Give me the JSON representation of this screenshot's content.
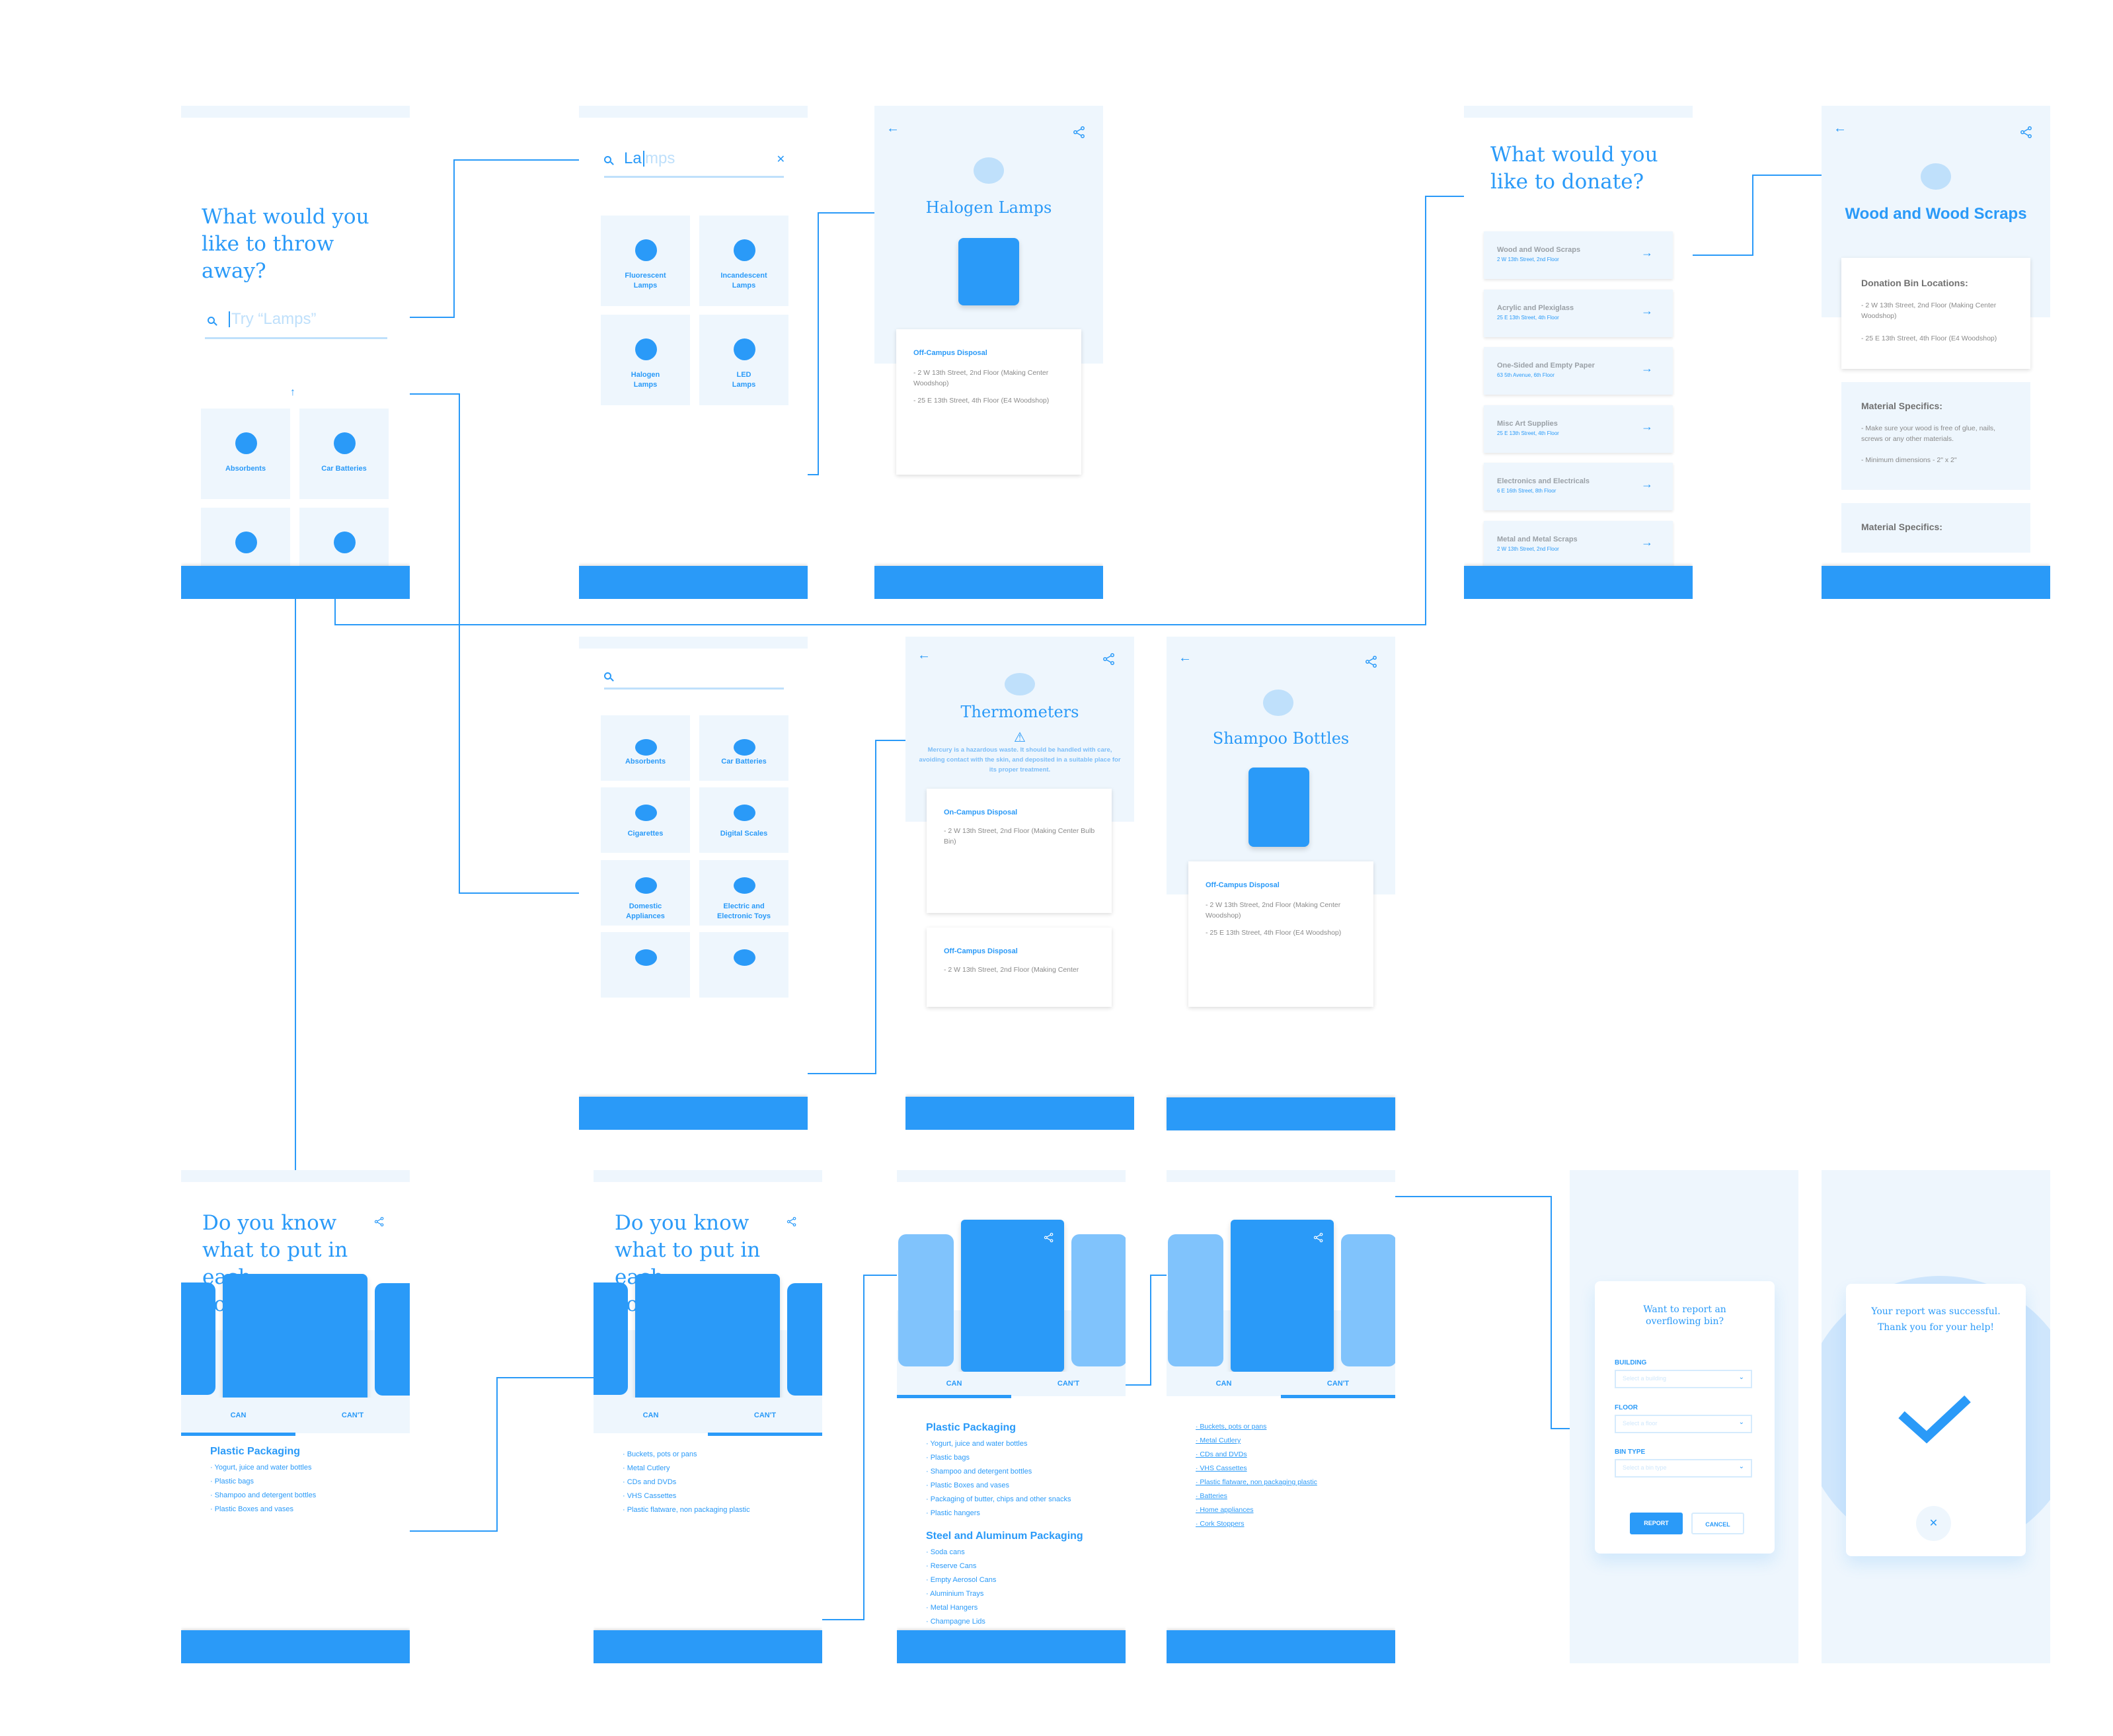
{
  "colors": {
    "primary": "#2a9af8",
    "light": "#eef6fd",
    "pale": "#bfe0fb",
    "muted_text": "#8a8a8a"
  },
  "screens": {
    "throw_home": {
      "title": "What would you like to throw away?",
      "search_placeholder": "Try “Lamps”",
      "scroll_up_icon": "↑",
      "categories": [
        {
          "label": "Absorbents"
        },
        {
          "label": "Car Batteries"
        },
        {
          "label": ""
        },
        {
          "label": ""
        }
      ]
    },
    "search_results": {
      "query_typed": "La",
      "query_suggest": "mps",
      "clear_icon": "✕",
      "results": [
        {
          "label": "Fluorescent Lamps"
        },
        {
          "label": "Incandescent Lamps"
        },
        {
          "label": "Halogen Lamps"
        },
        {
          "label": "LED Lamps"
        }
      ]
    },
    "halogen_detail": {
      "back_icon": "←",
      "title": "Halogen Lamps",
      "card_title": "Off-Campus Disposal",
      "addresses": [
        "- 2 W 13th Street, 2nd Floor (Making Center Woodshop)",
        "- 25 E 13th Street, 4th Floor (E4 Woodshop)"
      ]
    },
    "donate_list": {
      "title": "What would you like to donate?",
      "arrow_icon": "→",
      "items": [
        {
          "name": "Wood and Wood Scraps",
          "address": "2 W 13th Street, 2nd Floor"
        },
        {
          "name": "Acrylic and Plexiglass",
          "address": "25 E 13th Street, 4th Floor"
        },
        {
          "name": "One-Sided and Empty Paper",
          "address": "63 5th Avenue, 6th Floor"
        },
        {
          "name": "Misc Art Supplies",
          "address": "25 E 13th Street, 4th Floor"
        },
        {
          "name": "Electronics and Electricals",
          "address": "6 E 16th Street, 8th Floor"
        },
        {
          "name": "Metal and Metal Scraps",
          "address": "2 W 13th Street, 2nd Floor"
        }
      ]
    },
    "wood_detail": {
      "back_icon": "←",
      "title": "Wood and Wood Scraps",
      "bins_title": "Donation Bin Locations:",
      "bins": [
        "- 2 W 13th Street, 2nd Floor (Making Center Woodshop)",
        "- 25 E 13th Street, 4th Floor (E4 Woodshop)"
      ],
      "specifics_title": "Material Specifics:",
      "specifics": [
        "- Make sure your wood is free of glue, nails, screws or any other materials.",
        "- Minimum dimensions - 2\" x 2\""
      ],
      "specifics2_title": "Material Specifics:"
    },
    "category_list": {
      "categories": [
        {
          "label": "Absorbents"
        },
        {
          "label": "Car Batteries"
        },
        {
          "label": "Cigarettes"
        },
        {
          "label": "Digital Scales"
        },
        {
          "label": "Domestic Appliances"
        },
        {
          "label": "Electric and Electronic Toys"
        },
        {
          "label": ""
        },
        {
          "label": ""
        }
      ]
    },
    "thermometer_detail": {
      "back_icon": "←",
      "title": "Thermometers",
      "warning_icon": "⚠",
      "warning": "Mercury is a hazardous waste. It should be handled with care, avoiding contact with the skin, and deposited in a suitable place for its proper treatment.",
      "card1_title": "On-Campus Disposal",
      "card1_addresses": [
        "- 2 W 13th Street, 2nd Floor (Making Center Bulb Bin)"
      ],
      "card2_title": "Off-Campus Disposal",
      "card2_addresses": [
        "- 2 W 13th Street, 2nd Floor (Making Center"
      ]
    },
    "shampoo_detail": {
      "back_icon": "←",
      "title": "Shampoo Bottles",
      "card_title": "Off-Campus Disposal",
      "addresses": [
        "- 2 W 13th Street, 2nd Floor (Making Center Woodshop)",
        "- 25 E 13th Street, 4th Floor (E4 Woodshop)"
      ]
    },
    "containers_can": {
      "title": "Do you know what to put in each container?",
      "tab_can": "CAN",
      "tab_cant": "CAN'T",
      "section": "Plastic Packaging",
      "items": [
        "· Yogurt, juice and water bottles",
        "· Plastic bags",
        "· Shampoo and detergent bottles",
        "· Plastic Boxes and vases"
      ]
    },
    "containers_cant": {
      "title": "Do you know what to put in each container?",
      "tab_can": "CAN",
      "tab_cant": "CAN'T",
      "items": [
        "· Buckets, pots or pans",
        "· Metal Cutlery",
        "· CDs and DVDs",
        "· VHS Cassettes",
        "· Plastic flatware, non packaging plastic"
      ]
    },
    "scrolled_can": {
      "tab_can": "CAN",
      "tab_cant": "CAN'T",
      "section1": "Plastic Packaging",
      "items1": [
        "· Yogurt, juice and water bottles",
        "· Plastic bags",
        "· Shampoo and detergent bottles",
        "· Plastic Boxes and vases",
        "· Packaging of butter, chips and other snacks",
        "· Plastic hangers"
      ],
      "section2": "Steel and Aluminum Packaging",
      "items2": [
        "· Soda cans",
        "· Reserve Cans",
        "· Empty Aerosol Cans",
        "· Aluminium Trays",
        "· Metal Hangers",
        "· Champagne Lids"
      ]
    },
    "scrolled_cant": {
      "tab_can": "CAN",
      "tab_cant": "CAN'T",
      "items": [
        "· Buckets, pots or pans",
        "· Metal Cutlery",
        "· CDs and DVDs",
        "· VHS Cassettes",
        "· Plastic flatware, non packaging plastic",
        "· Batteries",
        "· Home appliances",
        "· Cork Stoppers"
      ]
    },
    "report_form": {
      "title": "Want to report an overflowing bin?",
      "fields": [
        {
          "label": "BUILDING",
          "placeholder": "Select a building"
        },
        {
          "label": "FLOOR",
          "placeholder": "Select a floor"
        },
        {
          "label": "BIN TYPE",
          "placeholder": "Select a bin type"
        }
      ],
      "chevron_icon": "⌄",
      "report_button": "REPORT",
      "cancel_button": "CANCEL"
    },
    "report_success": {
      "message": "Your report was successful. Thank you for your help!",
      "close_icon": "✕"
    }
  }
}
